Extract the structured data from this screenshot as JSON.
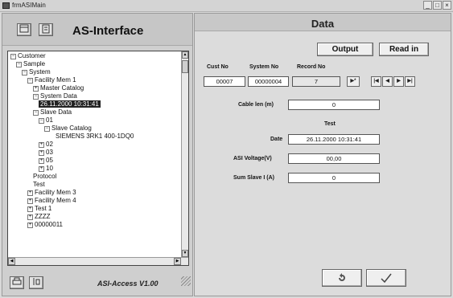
{
  "window": {
    "title": "frmASIMain",
    "controls": {
      "minimize": "_",
      "maximize": "□",
      "close": "×"
    }
  },
  "left": {
    "heading": "AS-Interface",
    "tool_icons": [
      "db-icon",
      "document-icon"
    ],
    "footer_version": "ASI-Access V1.00",
    "tree": [
      {
        "label": "Customer",
        "expander": "−",
        "indent": 0
      },
      {
        "label": "Sample",
        "expander": "−",
        "indent": 1
      },
      {
        "label": "System",
        "expander": "−",
        "indent": 2
      },
      {
        "label": "Facility Mem 1",
        "expander": "−",
        "indent": 3
      },
      {
        "label": "Master Catalog",
        "expander": "+",
        "indent": 4
      },
      {
        "label": "System Data",
        "expander": "−",
        "indent": 4
      },
      {
        "label": "26.11.2000 10:31:41",
        "expander": "",
        "indent": 5,
        "selected": true
      },
      {
        "label": "Slave Data",
        "expander": "−",
        "indent": 4
      },
      {
        "label": "01",
        "expander": "−",
        "indent": 5
      },
      {
        "label": "Slave Catalog",
        "expander": "−",
        "indent": 6
      },
      {
        "label": "SIEMENS 3RK1 400-1DQ0",
        "expander": "",
        "indent": 8
      },
      {
        "label": "02",
        "expander": "+",
        "indent": 5
      },
      {
        "label": "03",
        "expander": "+",
        "indent": 5
      },
      {
        "label": "05",
        "expander": "+",
        "indent": 5
      },
      {
        "label": "10",
        "expander": "+",
        "indent": 5
      },
      {
        "label": "Protocol",
        "expander": "",
        "indent": 4
      },
      {
        "label": "Test",
        "expander": "",
        "indent": 4
      },
      {
        "label": "Facility Mem 3",
        "expander": "+",
        "indent": 3
      },
      {
        "label": "Facility Mem 4",
        "expander": "+",
        "indent": 3
      },
      {
        "label": "Test 1",
        "expander": "+",
        "indent": 3
      },
      {
        "label": "ZZZZ",
        "expander": "+",
        "indent": 3
      },
      {
        "label": "00000011",
        "expander": "+",
        "indent": 3
      }
    ]
  },
  "right": {
    "title": "Data",
    "buttons": {
      "output": "Output",
      "read_in": "Read in"
    },
    "columns": {
      "cust_no": "Cust No",
      "system_no": "System No",
      "record_no": "Record No"
    },
    "values": {
      "cust_no": "00007",
      "system_no": "00000004",
      "record_no": "7"
    },
    "nav": {
      "new": "▶*",
      "first": "|◀",
      "prev": "◀",
      "next": "▶",
      "last": "▶|"
    },
    "cable_len_label": "Cable len (m)",
    "cable_len_value": "0",
    "section_label": "Test",
    "date_label": "Date",
    "date_value": "26.11.2000 10:31:41",
    "voltage_label": "ASI Voltage(V)",
    "voltage_value": "00,00",
    "sum_slave_label": "Sum Slave I (A)",
    "sum_slave_value": "0",
    "bottom_buttons": {
      "undo_icon": "undo-icon",
      "ok_icon": "check-icon"
    }
  }
}
